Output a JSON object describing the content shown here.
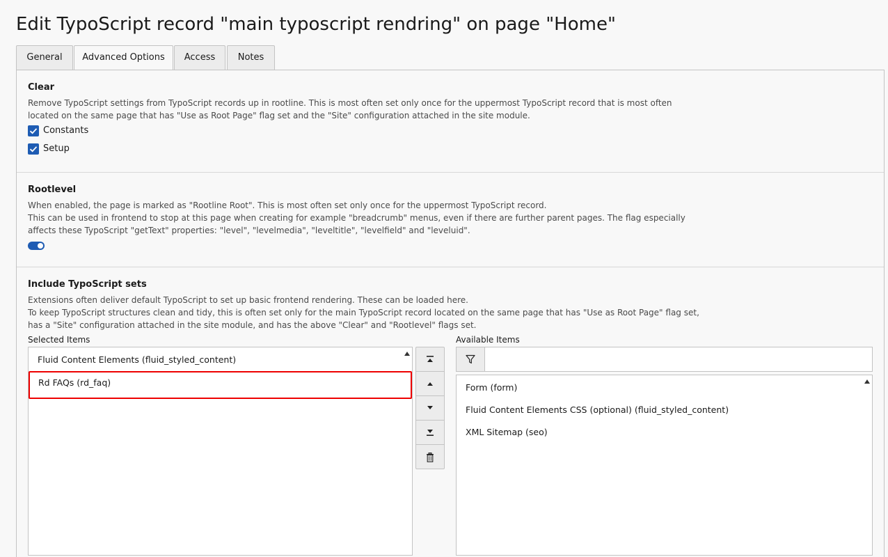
{
  "page": {
    "title": "Edit TypoScript record \"main typoscript rendring\" on page \"Home\""
  },
  "tabs": [
    {
      "label": "General",
      "active": false
    },
    {
      "label": "Advanced Options",
      "active": true
    },
    {
      "label": "Access",
      "active": false
    },
    {
      "label": "Notes",
      "active": false
    }
  ],
  "clear": {
    "title": "Clear",
    "desc_1": "Remove TypoScript settings from TypoScript records up in rootline. This is most often set only once for the uppermost TypoScript record that is most often",
    "desc_2": "located on the same page that has \"Use as Root Page\" flag set and the \"Site\" configuration attached in the site module.",
    "options": [
      {
        "label": "Constants",
        "checked": true
      },
      {
        "label": "Setup",
        "checked": true
      }
    ]
  },
  "rootlevel": {
    "title": "Rootlevel",
    "desc_1": "When enabled, the page is marked as \"Rootline Root\". This is most often set only once for the uppermost TypoScript record.",
    "desc_2": "This can be used in frontend to stop at this page when creating for example \"breadcrumb\" menus, even if there are further parent pages. The flag especially",
    "desc_3": "affects these TypoScript \"getText\" properties: \"level\", \"levelmedia\", \"leveltitle\", \"levelfield\" and \"leveluid\".",
    "enabled": true
  },
  "include": {
    "title": "Include TypoScript sets",
    "desc_1": "Extensions often deliver default TypoScript to set up basic frontend rendering. These can be loaded here.",
    "desc_2": "To keep TypoScript structures clean and tidy, this is often set only for the main TypoScript record located on the same page that has \"Use as Root Page\" flag set,",
    "desc_3": "has a \"Site\" configuration attached in the site module, and has the above \"Clear\" and \"Rootlevel\" flags set.",
    "selected_label": "Selected Items",
    "available_label": "Available Items",
    "selected_items": [
      "Fluid Content Elements (fluid_styled_content)",
      "Rd FAQs (rd_faq)"
    ],
    "available_items": [
      "Form (form)",
      "Fluid Content Elements CSS (optional) (fluid_styled_content)",
      "XML Sitemap (seo)"
    ],
    "filter_placeholder": "",
    "buttons": [
      "move-top-icon",
      "move-up-icon",
      "move-down-icon",
      "move-bottom-icon",
      "trash-icon"
    ]
  },
  "colors": {
    "accent": "#1e5cb3",
    "highlight": "#ee0000"
  }
}
